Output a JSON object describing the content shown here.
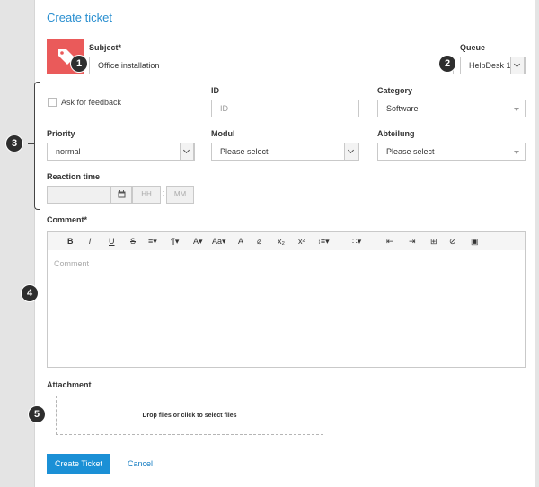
{
  "title": "Create ticket",
  "subject": {
    "label": "Subject*",
    "value": "Office installation"
  },
  "queue": {
    "label": "Queue",
    "value": "HelpDesk 1"
  },
  "feedback": {
    "label": "Ask for feedback"
  },
  "id_field": {
    "label": "ID",
    "placeholder": "ID"
  },
  "category": {
    "label": "Category",
    "value": "Software"
  },
  "priority": {
    "label": "Priority",
    "value": "normal"
  },
  "modul": {
    "label": "Modul",
    "value": "Please select"
  },
  "abteilung": {
    "label": "Abteilung",
    "value": "Please select"
  },
  "reaction_time": {
    "label": "Reaction time",
    "hh": "HH",
    "mm": "MM"
  },
  "comment": {
    "label": "Comment*",
    "placeholder": "Comment",
    "toolbar": [
      "B",
      "i",
      "U",
      "S",
      "≡▾",
      "¶▾",
      "A▾",
      "Aa▾",
      "A",
      "⌀",
      "x₂",
      "x²",
      "⁝≡▾",
      "∷▾",
      "⇤",
      "⇥",
      "⊞",
      "⊘",
      "▣"
    ]
  },
  "attachment": {
    "label": "Attachment",
    "drop_text": "Drop files or click to select files"
  },
  "actions": {
    "create": "Create Ticket",
    "cancel": "Cancel"
  },
  "markers": [
    "1",
    "2",
    "3",
    "4",
    "5"
  ],
  "colors": {
    "accent": "#1b90d6",
    "title": "#2a8fd0",
    "tag_icon": "#ea5a5a",
    "marker": "#2e2e2e"
  }
}
